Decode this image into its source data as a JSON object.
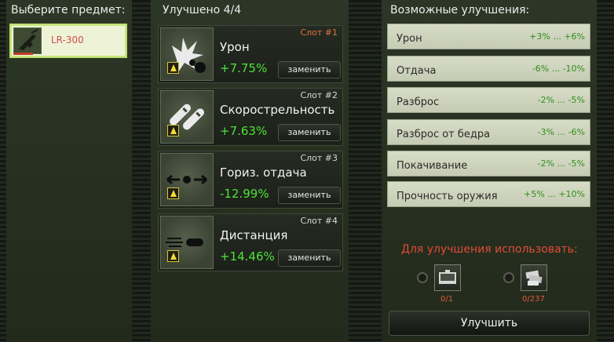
{
  "left": {
    "title": "Выберите предмет:",
    "item": {
      "name": "LR-300",
      "icon": "rifle-icon"
    }
  },
  "middle": {
    "title": "Улучшено 4/4",
    "replace_label": "заменить",
    "slots": [
      {
        "slot": "Слот #1",
        "name": "Урон",
        "value": "+7.75%",
        "icon": "explosion-icon",
        "active": true
      },
      {
        "slot": "Слот #2",
        "name": "Скорострельность",
        "value": "+7.63%",
        "icon": "bullets-icon",
        "active": false
      },
      {
        "slot": "Слот #3",
        "name": "Гориз. отдача",
        "value": "-12.99%",
        "icon": "horizontal-recoil-icon",
        "active": false
      },
      {
        "slot": "Слот #4",
        "name": "Дистанция",
        "value": "+14.46%",
        "icon": "flying-bullet-icon",
        "active": false
      }
    ]
  },
  "right": {
    "title": "Возможные улучшения:",
    "upgrades": [
      {
        "name": "Урон",
        "range": "+3% ... +6%"
      },
      {
        "name": "Отдача",
        "range": "-6% ... -10%"
      },
      {
        "name": "Разброс",
        "range": "-2% ... -5%"
      },
      {
        "name": "Разброс от бедра",
        "range": "-3% ... -6%"
      },
      {
        "name": "Покачивание",
        "range": "-2% ... -5%"
      },
      {
        "name": "Прочность оружия",
        "range": "+5% ... +10%"
      }
    ],
    "use_title": "Для улучшения использовать:",
    "resources": [
      {
        "icon": "toolkit-icon",
        "count": "0/1"
      },
      {
        "icon": "scrap-parts-icon",
        "count": "0/237"
      }
    ],
    "upgrade_button": "Улучшить"
  },
  "colors": {
    "accent_green": "#4ee23a",
    "slot_active": "#e0733a",
    "warning_red": "#e14a36",
    "item_name_red": "#d04d4d"
  }
}
